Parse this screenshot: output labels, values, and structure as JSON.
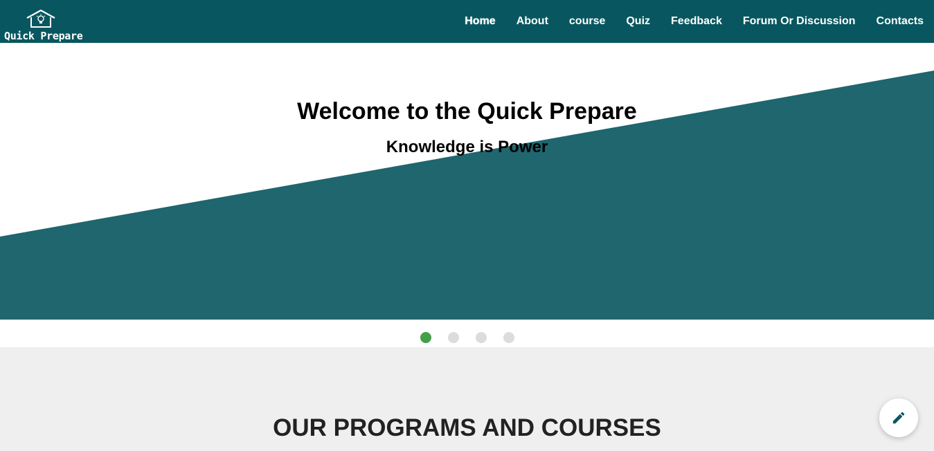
{
  "brand": {
    "name": "Quick Prepare",
    "logo_icon": "house-lightbulb-icon"
  },
  "nav": {
    "items": [
      {
        "label": "Home",
        "active": true
      },
      {
        "label": "About",
        "active": false
      },
      {
        "label": "course",
        "active": false
      },
      {
        "label": "Quiz",
        "active": false
      },
      {
        "label": "Feedback",
        "active": false
      },
      {
        "label": "Forum Or Discussion",
        "active": false
      },
      {
        "label": "Contacts",
        "active": false
      }
    ]
  },
  "hero": {
    "title": "Welcome to the Quick Prepare",
    "subtitle": "Knowledge is Power"
  },
  "carousel": {
    "slide_count": 4,
    "active_index": 0
  },
  "programs": {
    "heading": "OUR PROGRAMS AND COURSES"
  },
  "fab": {
    "icon": "pencil-icon"
  },
  "colors": {
    "navbar": "#085760",
    "hero_band": "#1f666e",
    "dot_active": "#43a047",
    "dot_inactive": "#dcdcdc",
    "section_bg": "#efefef",
    "fab_icon": "#085760"
  }
}
